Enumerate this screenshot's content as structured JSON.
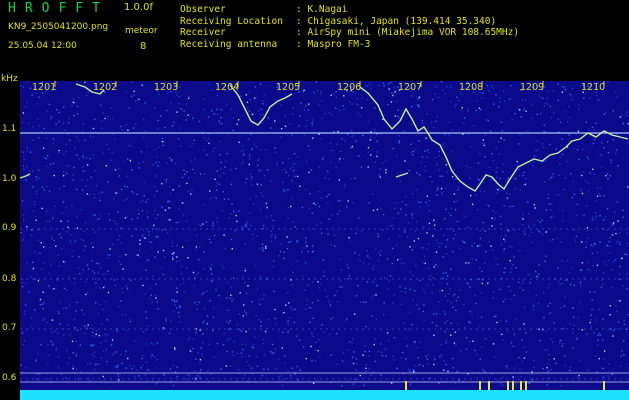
{
  "header": {
    "logo": "HROFFT",
    "version": "1.0.0f",
    "filename": "KN9_2505041200.png",
    "datetime": "25.05.04 12:00",
    "meteor_label": "meteor",
    "meteor_count": "8"
  },
  "info": {
    "observer": {
      "label": "Observer",
      "value": ": K.Nagai"
    },
    "location": {
      "label": "Receiving Location",
      "value": ": Chigasaki, Japan (139.414 35.340)"
    },
    "receiver": {
      "label": "Receiver",
      "value": ": AirSpy mini (Miakejima VOR 108.65MHz)"
    },
    "antenna": {
      "label": "Receiving antenna",
      "value": ": Maspro FM-3"
    }
  },
  "spectrogram": {
    "y_unit": "kHz",
    "y_ticks": [
      "1.1",
      "1.0",
      "0.9",
      "0.8",
      "0.7",
      "0.6"
    ],
    "x_ticks": [
      "1201",
      "1202",
      "1203",
      "1204",
      "1205",
      "1206",
      "1207",
      "1208",
      "1209",
      "1210"
    ],
    "colors": {
      "background": "#0a0a8a",
      "noise": "#3060ff",
      "trace": "#c0f0a0",
      "baseline": "#20e0ff",
      "tick": "#e0e020"
    }
  }
}
